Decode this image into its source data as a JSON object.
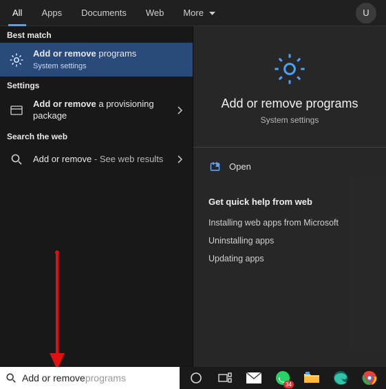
{
  "tabs": {
    "all": "All",
    "apps": "Apps",
    "documents": "Documents",
    "web": "Web",
    "more": "More"
  },
  "avatar_letter": "U",
  "left": {
    "best_match_hdr": "Best match",
    "best_match": {
      "title": "Add or remove programs",
      "title_prefix": "Add or remove",
      "title_suffix": " programs",
      "sub": "System settings"
    },
    "settings_hdr": "Settings",
    "settings_item": {
      "prefix": "Add or remove",
      "suffix": " a provisioning package"
    },
    "web_hdr": "Search the web",
    "web_item": {
      "prefix": "Add or remove",
      "suffix": " - See web results"
    }
  },
  "right": {
    "title": "Add or remove programs",
    "sub": "System settings",
    "open_label": "Open",
    "quick_hdr": "Get quick help from web",
    "links": [
      "Installing web apps from Microsoft",
      "Uninstalling apps",
      "Updating apps"
    ]
  },
  "search": {
    "typed": "Add or remove ",
    "ghost": "programs"
  },
  "taskbar": {
    "whatsapp_badge": "34"
  },
  "colors": {
    "accent": "#4aa3ff",
    "best_match_bg": "#2a4a7a"
  }
}
